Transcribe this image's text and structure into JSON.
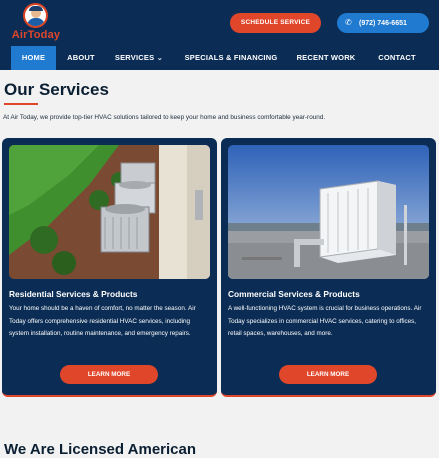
{
  "header": {
    "logo_text": "AirToday",
    "schedule_label": "SCHEDULE SERVICE",
    "phone_label": "(972) 746-6651"
  },
  "nav": {
    "items": [
      {
        "label": "HOME"
      },
      {
        "label": "ABOUT"
      },
      {
        "label": "SERVICES ⌄"
      },
      {
        "label": "SPECIALS & FINANCING"
      },
      {
        "label": "RECENT WORK"
      },
      {
        "label": "CONTACT"
      }
    ]
  },
  "services": {
    "title": "Our Services",
    "intro": "At Air Today, we provide top-tier HVAC solutions tailored to keep your home and business comfortable year-round.",
    "cards": [
      {
        "title": "Residential Services & Products",
        "text": "Your home should be a haven of comfort, no matter the season. Air Today offers comprehensive residential HVAC services, including system installation, routine maintenance, and emergency repairs.",
        "button": "LEARN MORE"
      },
      {
        "title": "Commercial Services & Products",
        "text": "A well-functioning HVAC system is crucial for business operations. Air Today specializes in commercial HVAC services, catering to offices, retail spaces, warehouses, and more.",
        "button": "LEARN MORE"
      }
    ]
  },
  "next_section": {
    "title": "We Are Licensed American"
  },
  "colors": {
    "navy": "#0b2d55",
    "accent": "#e0462a",
    "blue": "#1f7ad0"
  },
  "icons": [
    "phone-icon",
    "chevron-down-icon"
  ]
}
